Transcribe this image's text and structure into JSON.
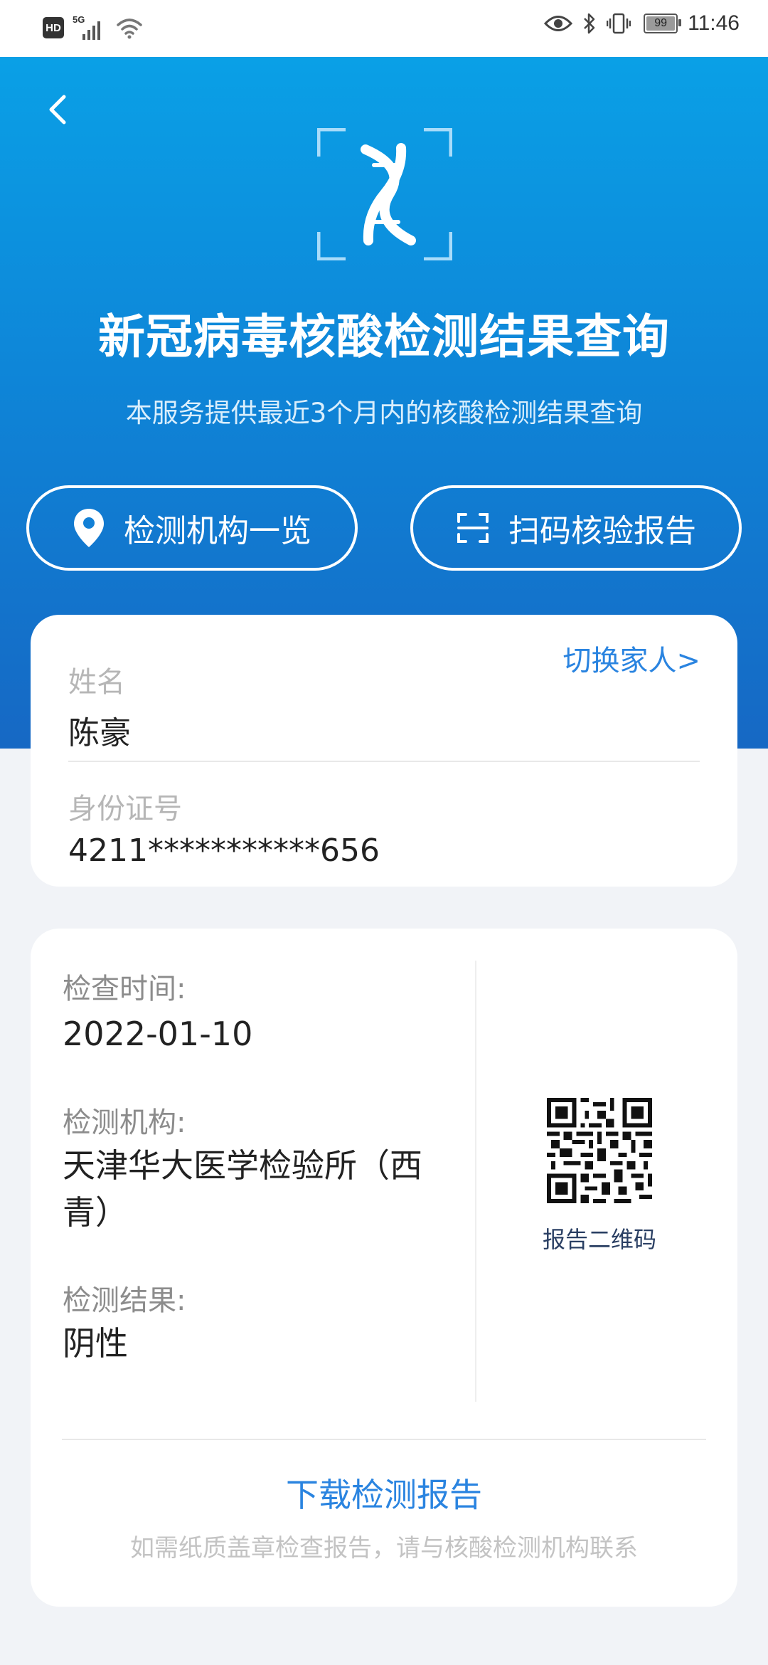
{
  "status_bar": {
    "hd_label": "HD",
    "network_label": "5G",
    "battery_level": "99",
    "time": "11:46"
  },
  "header": {
    "title": "新冠病毒核酸检测结果查询",
    "subtitle": "本服务提供最近3个月内的核酸检测结果查询",
    "buttons": {
      "institutions": "检测机构一览",
      "scan_verify": "扫码核验报告"
    }
  },
  "identity": {
    "switch_family": "切换家人>",
    "name_label": "姓名",
    "name_value": "陈豪",
    "id_label": "身份证号",
    "id_value": "4211***********656"
  },
  "result": {
    "time_label": "检查时间:",
    "time_value": "2022-01-10",
    "institution_label": "检测机构:",
    "institution_value": "天津华大医学检验所（西青）",
    "result_label": "检测结果:",
    "result_value": "阴性",
    "qr_caption": "报告二维码",
    "download_label": "下载检测报告",
    "paper_note": "如需纸质盖章检查报告，请与核酸检测机构联系"
  },
  "colors": {
    "header_top": "#0aa0e6",
    "header_bottom": "#1668c4",
    "link_blue": "#2a84e0",
    "page_bg": "#f1f3f7"
  },
  "icons": [
    "hd-icon",
    "signal-5g-icon",
    "wifi-icon",
    "eye-icon",
    "bluetooth-icon",
    "vibrate-icon",
    "battery-icon",
    "back-arrow-icon",
    "dna-scan-icon",
    "location-pin-icon",
    "scan-icon",
    "qr-code-icon"
  ]
}
